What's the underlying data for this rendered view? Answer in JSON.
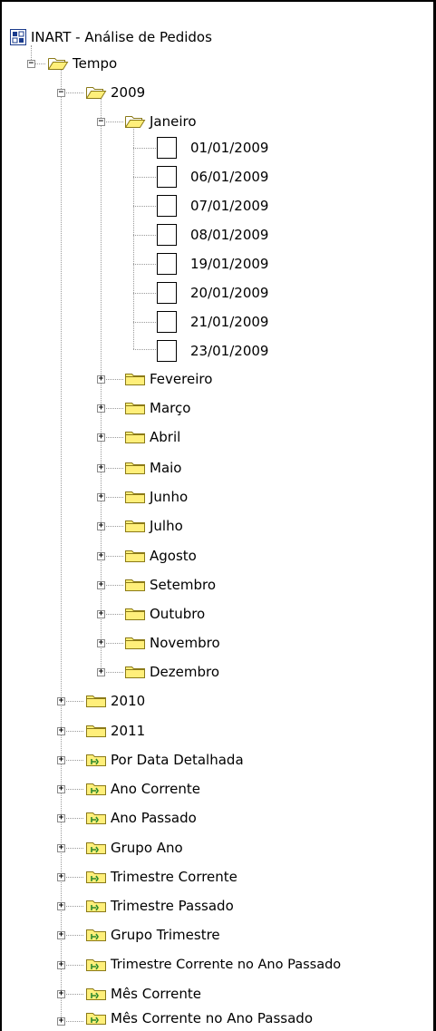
{
  "root": {
    "label": "INART - Análise de Pedidos",
    "icon": "cube-icon"
  },
  "tempo": {
    "label": "Tempo",
    "state": "expanded"
  },
  "year_2009": {
    "label": "2009",
    "state": "expanded"
  },
  "janeiro": {
    "label": "Janeiro",
    "state": "expanded"
  },
  "days": [
    "01/01/2009",
    "06/01/2009",
    "07/01/2009",
    "08/01/2009",
    "19/01/2009",
    "20/01/2009",
    "21/01/2009",
    "23/01/2009"
  ],
  "months": [
    "Fevereiro",
    "Março",
    "Abril",
    "Maio",
    "Junho",
    "Julho",
    "Agosto",
    "Setembro",
    "Outubro",
    "Novembro",
    "Dezembro"
  ],
  "years": [
    "2010",
    "2011"
  ],
  "hierarchies": [
    "Por Data Detalhada",
    "Ano Corrente",
    "Ano Passado",
    "Grupo Ano",
    "Trimestre Corrente",
    "Trimestre Passado",
    "Grupo Trimestre",
    "Trimestre Corrente no Ano Passado",
    "Mês Corrente",
    "Mês Corrente no Ano Passado"
  ],
  "colors": {
    "folder_fill": "#ffef7a",
    "folder_stroke": "#8b7a18",
    "hier_icon": "#2e8b2e",
    "line": "#9a9a9a"
  },
  "icons": {
    "closed_folder": "folder-icon",
    "open_folder": "folder-open-icon",
    "member": "member-box-icon",
    "hierarchy": "hierarchy-folder-icon",
    "expand": "expand-plus-icon",
    "collapse": "collapse-minus-icon"
  }
}
